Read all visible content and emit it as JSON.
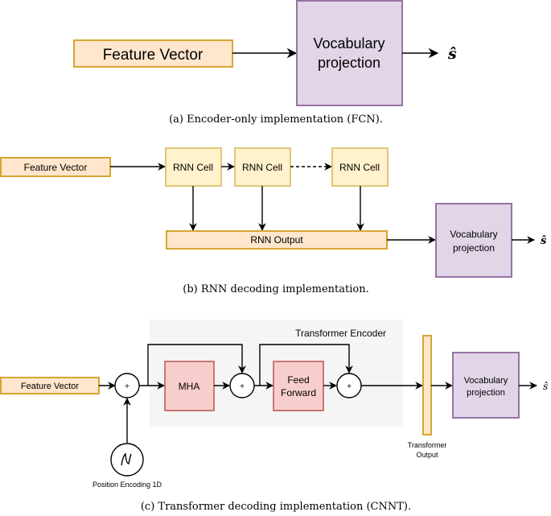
{
  "panel_a": {
    "feature_vector": "Feature Vector",
    "vocab_line1": "Vocabulary",
    "vocab_line2": "projection",
    "output_symbol": "ŝ",
    "caption": "(a) Encoder-only implementation (FCN)."
  },
  "panel_b": {
    "feature_vector": "Feature Vector",
    "rnn_cells": [
      "RNN Cell",
      "RNN Cell",
      "RNN Cell"
    ],
    "rnn_output": "RNN Output",
    "vocab_line1": "Vocabulary",
    "vocab_line2": "projection",
    "output_symbol": "ŝ",
    "caption": "(b) RNN decoding implementation."
  },
  "panel_c": {
    "feature_vector": "Feature Vector",
    "plus": "+",
    "encoder_label": "Transformer Encoder",
    "mha": "MHA",
    "ff_line1": "Feed",
    "ff_line2": "Forward",
    "transformer_output_line1": "Transformer",
    "transformer_output_line2": "Output",
    "position_encoding": "Position Encoding 1D",
    "vocab_line1": "Vocabulary",
    "vocab_line2": "projection",
    "output_symbol": "ŝ",
    "caption": "(c) Transformer decoding implementation (CNNT)."
  }
}
